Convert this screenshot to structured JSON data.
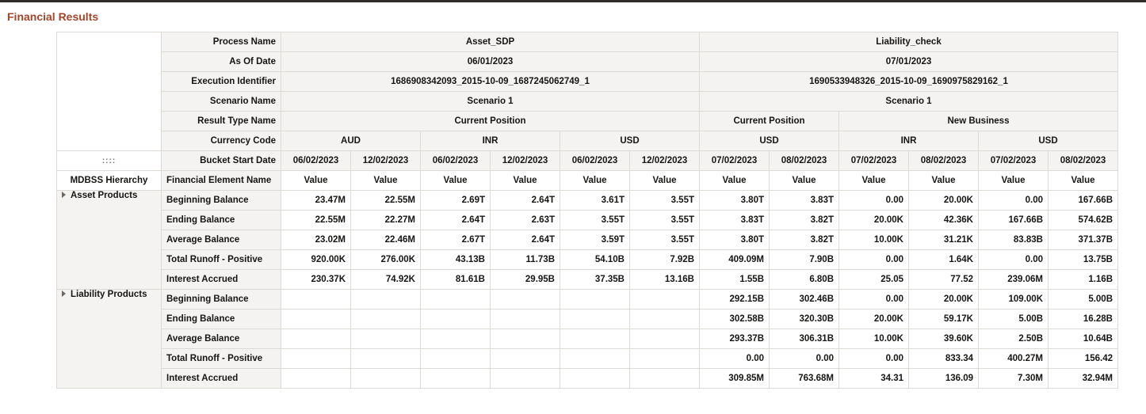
{
  "page": {
    "title": "Financial Results"
  },
  "pivot": {
    "handle": "::::",
    "col_labels": {
      "process_name": "Process Name",
      "as_of_date": "As Of Date",
      "execution_identifier": "Execution Identifier",
      "scenario_name": "Scenario Name",
      "result_type_name": "Result Type Name",
      "currency_code": "Currency Code",
      "bucket_start_date": "Bucket Start Date",
      "financial_element_name": "Financial Element Name"
    },
    "row_dim_label": "MDBSS Hierarchy",
    "processes": [
      {
        "name": "Asset_SDP",
        "as_of": "06/01/2023",
        "exec_id": "1686908342093_2015-10-09_1687245062749_1",
        "scenario": "Scenario 1",
        "result_type": "Current Position"
      },
      {
        "name": "Liability_check",
        "as_of": "07/01/2023",
        "exec_id": "1690533948326_2015-10-09_1690975829162_1",
        "scenario": "Scenario 1",
        "result_types": [
          "Current Position",
          "New Business"
        ]
      }
    ],
    "currencies": [
      "AUD",
      "INR",
      "USD",
      "USD",
      "INR",
      "USD"
    ],
    "bucket_dates": [
      "06/02/2023",
      "12/02/2023",
      "06/02/2023",
      "12/02/2023",
      "06/02/2023",
      "12/02/2023",
      "07/02/2023",
      "08/02/2023",
      "07/02/2023",
      "08/02/2023",
      "07/02/2023",
      "08/02/2023"
    ],
    "measure": "Value",
    "groups": [
      {
        "name": "Asset Products",
        "rows": [
          {
            "label": "Beginning Balance",
            "values": [
              "23.47M",
              "22.55M",
              "2.69T",
              "2.64T",
              "3.61T",
              "3.55T",
              "3.80T",
              "3.83T",
              "0.00",
              "20.00K",
              "0.00",
              "167.66B"
            ]
          },
          {
            "label": "Ending Balance",
            "values": [
              "22.55M",
              "22.27M",
              "2.64T",
              "2.63T",
              "3.55T",
              "3.55T",
              "3.83T",
              "3.82T",
              "20.00K",
              "42.36K",
              "167.66B",
              "574.62B"
            ]
          },
          {
            "label": "Average Balance",
            "values": [
              "23.02M",
              "22.46M",
              "2.67T",
              "2.64T",
              "3.59T",
              "3.55T",
              "3.80T",
              "3.82T",
              "10.00K",
              "31.21K",
              "83.83B",
              "371.37B"
            ]
          },
          {
            "label": "Total Runoff - Positive",
            "values": [
              "920.00K",
              "276.00K",
              "43.13B",
              "11.73B",
              "54.10B",
              "7.92B",
              "409.09M",
              "7.90B",
              "0.00",
              "1.64K",
              "0.00",
              "13.75B"
            ]
          },
          {
            "label": "Interest Accrued",
            "values": [
              "230.37K",
              "74.92K",
              "81.61B",
              "29.95B",
              "37.35B",
              "13.16B",
              "1.55B",
              "6.80B",
              "25.05",
              "77.52",
              "239.06M",
              "1.16B"
            ]
          }
        ]
      },
      {
        "name": "Liability Products",
        "rows": [
          {
            "label": "Beginning Balance",
            "values": [
              "",
              "",
              "",
              "",
              "",
              "",
              "292.15B",
              "302.46B",
              "0.00",
              "20.00K",
              "109.00K",
              "5.00B"
            ]
          },
          {
            "label": "Ending Balance",
            "values": [
              "",
              "",
              "",
              "",
              "",
              "",
              "302.58B",
              "320.30B",
              "20.00K",
              "59.17K",
              "5.00B",
              "16.28B"
            ]
          },
          {
            "label": "Average Balance",
            "values": [
              "",
              "",
              "",
              "",
              "",
              "",
              "293.37B",
              "306.31B",
              "10.00K",
              "39.60K",
              "2.50B",
              "10.64B"
            ]
          },
          {
            "label": "Total Runoff - Positive",
            "values": [
              "",
              "",
              "",
              "",
              "",
              "",
              "0.00",
              "0.00",
              "0.00",
              "833.34",
              "400.27M",
              "156.42"
            ]
          },
          {
            "label": "Interest Accrued",
            "values": [
              "",
              "",
              "",
              "",
              "",
              "",
              "309.85M",
              "763.68M",
              "34.31",
              "136.09",
              "7.30M",
              "32.94M"
            ]
          }
        ]
      }
    ]
  }
}
